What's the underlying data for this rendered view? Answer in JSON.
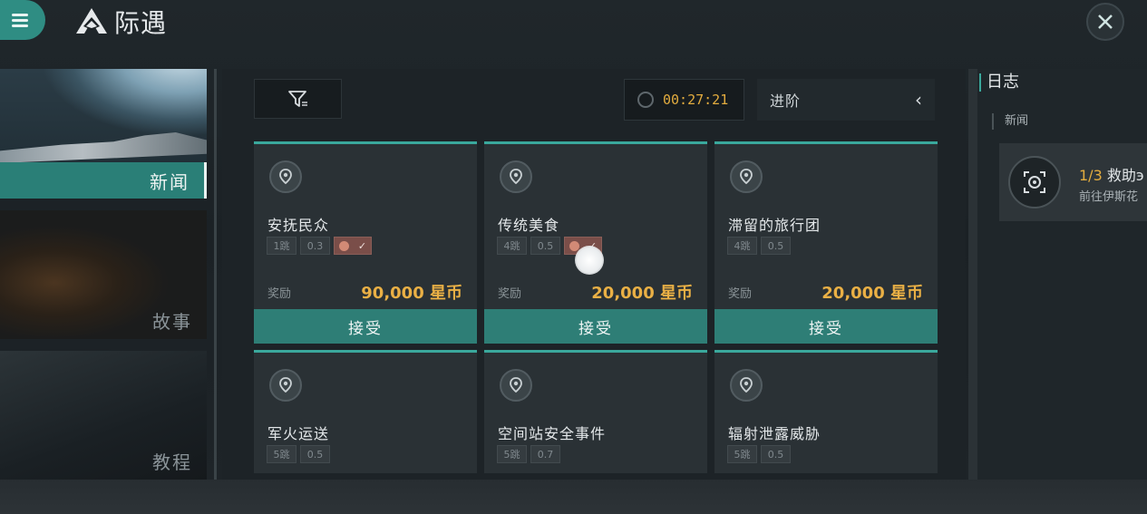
{
  "header": {
    "title": "际遇",
    "menu_icon": "hamburger-icon",
    "close_icon": "close-icon"
  },
  "categories": [
    {
      "label": "新闻",
      "active": true
    },
    {
      "label": "故事",
      "active": false
    },
    {
      "label": "教程",
      "active": false
    }
  ],
  "toolbar": {
    "filter_icon": "filter-icon",
    "timer": "00:27:21",
    "advanced_label": "进阶"
  },
  "missions": [
    {
      "name": "安抚民众",
      "tags": [
        "1跳",
        "0.3"
      ],
      "marked": true,
      "reward_label": "奖励",
      "reward": "90,000 星币",
      "accept": "接受"
    },
    {
      "name": "传统美食",
      "tags": [
        "4跳",
        "0.5"
      ],
      "marked": true,
      "reward_label": "奖励",
      "reward": "20,000 星币",
      "accept": "接受"
    },
    {
      "name": "滞留的旅行团",
      "tags": [
        "4跳",
        "0.5"
      ],
      "marked": false,
      "reward_label": "奖励",
      "reward": "20,000 星币",
      "accept": "接受"
    },
    {
      "name": "军火运送",
      "tags": [
        "5跳",
        "0.5"
      ],
      "marked": false
    },
    {
      "name": "空间站安全事件",
      "tags": [
        "5跳",
        "0.7"
      ],
      "marked": false
    },
    {
      "name": "辐射泄露威胁",
      "tags": [
        "5跳",
        "0.5"
      ],
      "marked": false
    }
  ],
  "log": {
    "title": "日志",
    "section": "新闻",
    "entry_count": "1/3",
    "entry_title": "救助э",
    "entry_desc": "前往伊斯花"
  },
  "colors": {
    "accent": "#2e7e76",
    "reward": "#eab045",
    "timer": "#e3ac3f"
  }
}
